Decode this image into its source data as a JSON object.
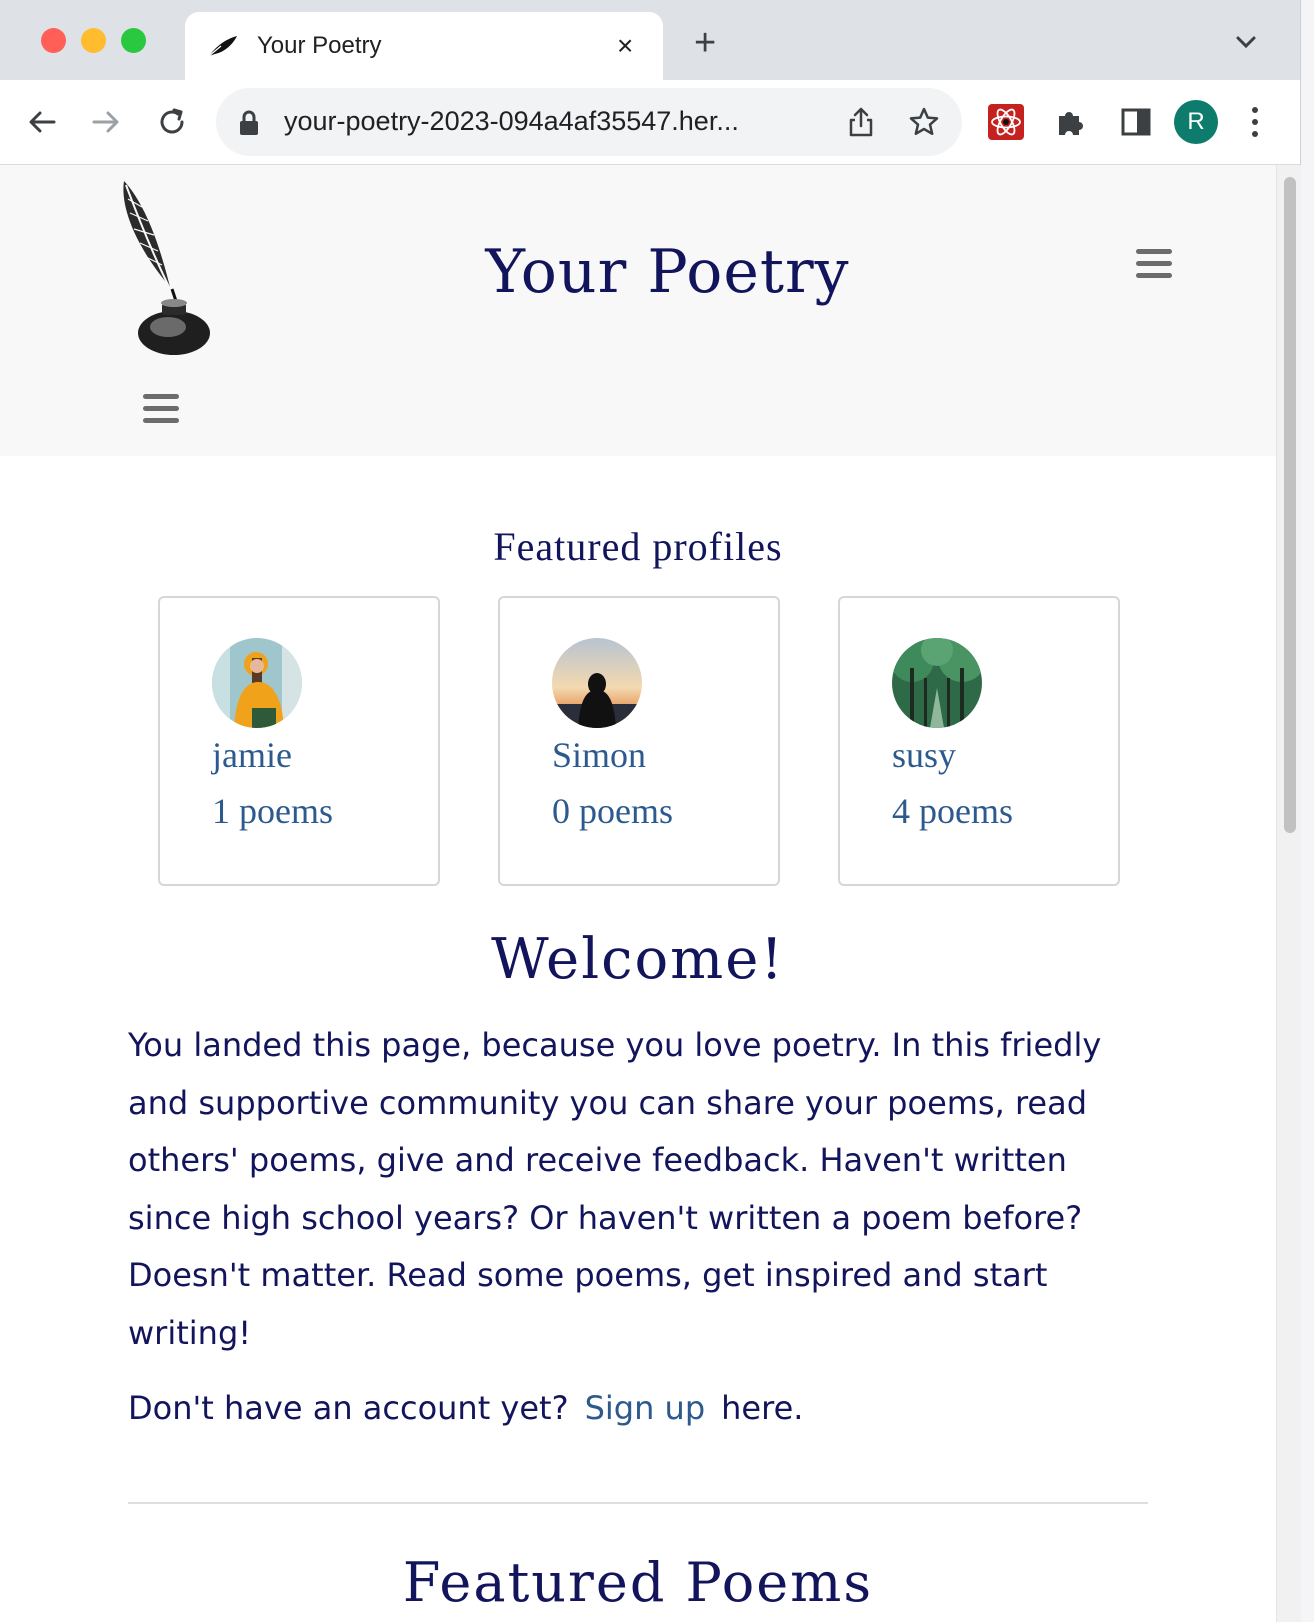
{
  "browser": {
    "tab_title": "Your Poetry",
    "new_tab_symbol": "+",
    "close_symbol": "×",
    "url": "your-poetry-2023-094a4af35547.her...",
    "profile_initial": "R",
    "colors": {
      "tabstrip": "#dee1e6",
      "profile_avatar": "#0d7c6c"
    }
  },
  "header": {
    "site_title": "Your Poetry"
  },
  "featured_profiles": {
    "title": "Featured profiles",
    "profiles": [
      {
        "name": "jamie",
        "poems": "1 poems"
      },
      {
        "name": "Simon",
        "poems": "0 poems"
      },
      {
        "name": "susy",
        "poems": "4 poems"
      }
    ]
  },
  "welcome": {
    "title": "Welcome!",
    "text": "You landed this page, because you love poetry. In this friedly and supportive community you can share your poems, read others' poems, give and receive feedback. Haven't written since high school years? Or haven't written a poem before? Doesn't matter. Read some poems, get inspired and start writing!",
    "signup_prefix": "Don't have an account yet?",
    "signup_link": "Sign up",
    "signup_suffix": "here."
  },
  "featured_poems": {
    "title": "Featured Poems"
  },
  "colors": {
    "brand_navy": "#13155c",
    "link_blue": "#2d5a8e",
    "header_bg": "#f8f8f8"
  }
}
